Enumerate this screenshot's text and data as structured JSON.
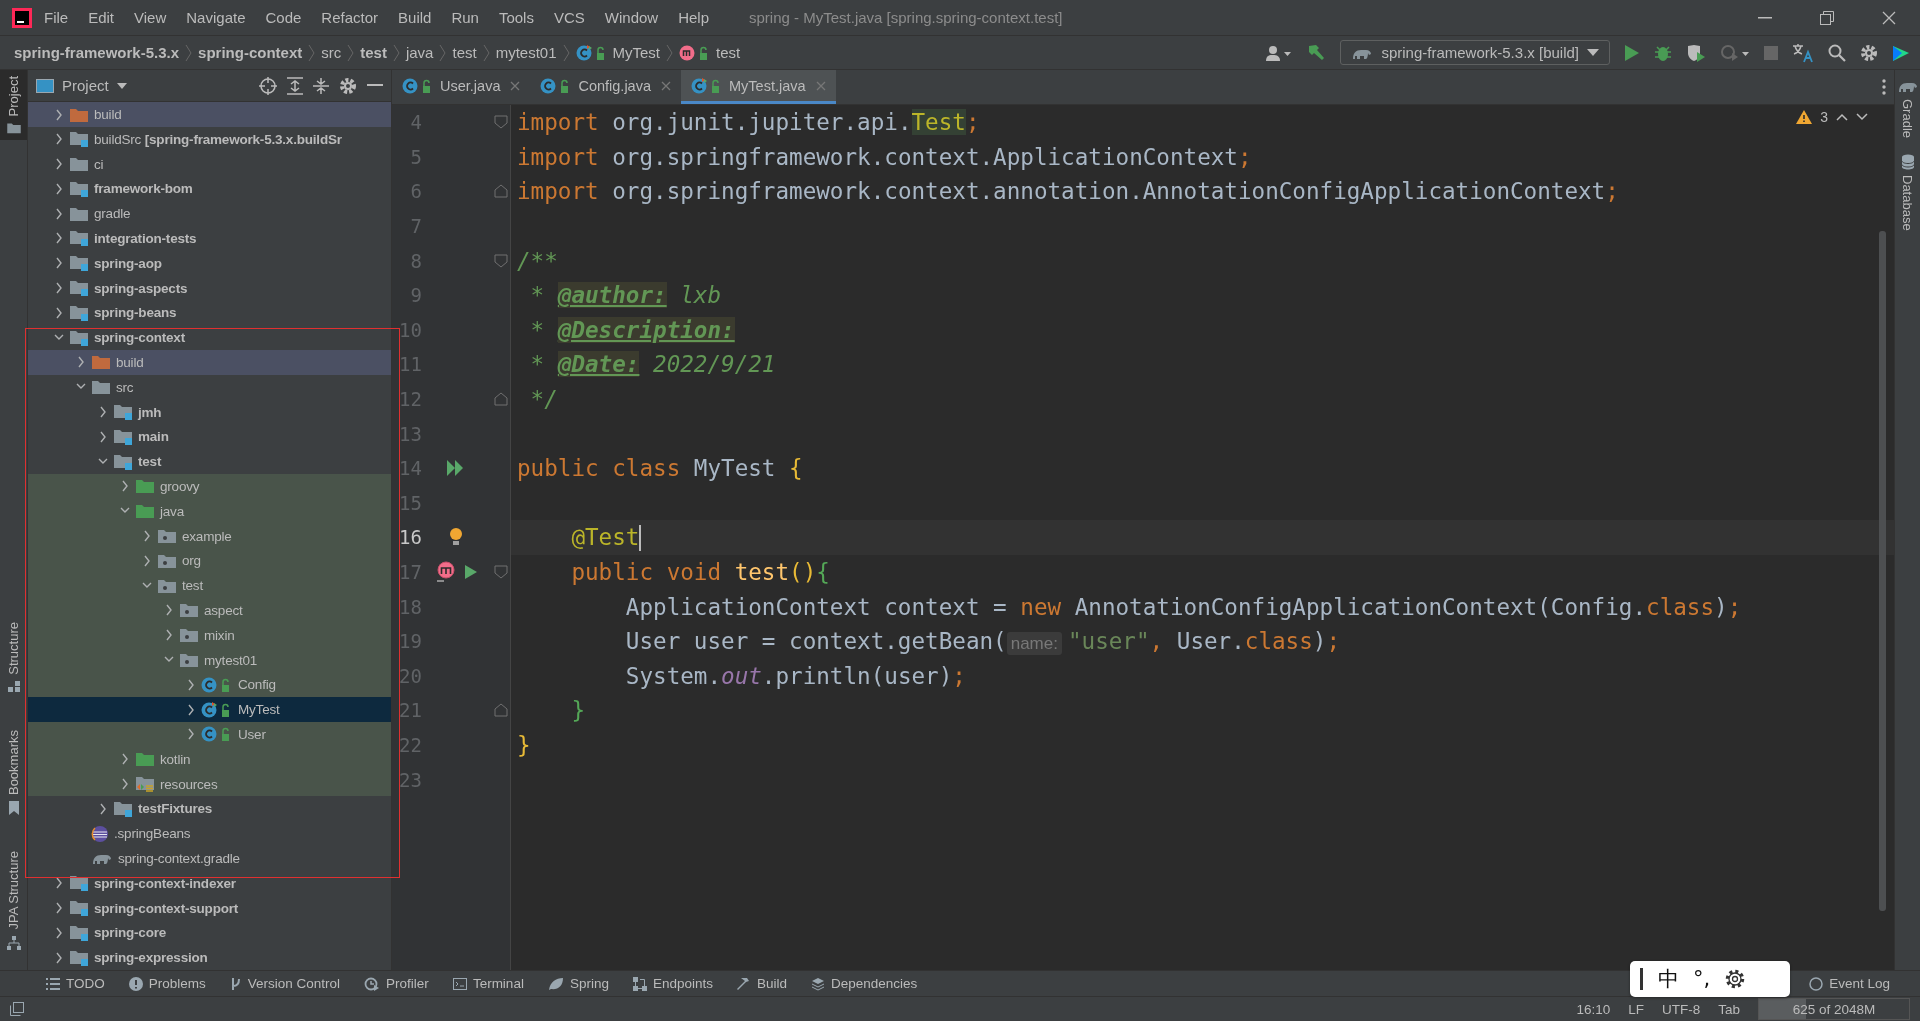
{
  "menu": [
    "File",
    "Edit",
    "View",
    "Navigate",
    "Code",
    "Refactor",
    "Build",
    "Run",
    "Tools",
    "VCS",
    "Window",
    "Help"
  ],
  "window": {
    "title": "spring - MyTest.java [spring.spring-context.test]"
  },
  "breadcrumbs": [
    {
      "label": "spring-framework-5.3.x",
      "bold": true,
      "kind": "plain"
    },
    {
      "label": "spring-context",
      "bold": true,
      "kind": "plain"
    },
    {
      "label": "src",
      "bold": false,
      "kind": "plain"
    },
    {
      "label": "test",
      "bold": true,
      "kind": "plain"
    },
    {
      "label": "java",
      "bold": false,
      "kind": "plain"
    },
    {
      "label": "test",
      "bold": false,
      "kind": "plain"
    },
    {
      "label": "mytest01",
      "bold": false,
      "kind": "plain"
    },
    {
      "label": "MyTest",
      "bold": false,
      "kind": "testclass"
    },
    {
      "label": "test",
      "bold": false,
      "kind": "method"
    }
  ],
  "run_config": {
    "label": "spring-framework-5.3.x [build]"
  },
  "left_stripe": [
    {
      "label": "Project",
      "selected": true,
      "kind": "folder"
    },
    {
      "label": "Structure",
      "selected": false,
      "kind": "structure"
    },
    {
      "label": "Bookmarks",
      "selected": false,
      "kind": "bookmark"
    },
    {
      "label": "JPA Structure",
      "selected": false,
      "kind": "hierarchy"
    }
  ],
  "right_stripe": [
    {
      "label": "Gradle",
      "kind": "gradle"
    },
    {
      "label": "Database",
      "kind": "database"
    }
  ],
  "project_panel": {
    "title": "Project",
    "tree": [
      {
        "label": "build",
        "kind": "folder",
        "excluded": true,
        "test_source": false,
        "selected": false,
        "expanded": false
      },
      {
        "label": "buildSrc **[spring-framework-5.3.x.buildSr**",
        "kind": "module",
        "excluded": false,
        "test_source": false,
        "selected": false,
        "expanded": false
      },
      {
        "label": "ci",
        "kind": "folder",
        "excluded": false,
        "test_source": false,
        "selected": false,
        "expanded": false
      },
      {
        "label": "**framework-bom**",
        "kind": "module",
        "excluded": false,
        "test_source": false,
        "selected": false,
        "expanded": false
      },
      {
        "label": "gradle",
        "kind": "folder",
        "excluded": false,
        "test_source": false,
        "selected": false,
        "expanded": false
      },
      {
        "label": "**integration-tests**",
        "kind": "module",
        "excluded": false,
        "test_source": false,
        "selected": false,
        "expanded": false
      },
      {
        "label": "**spring-aop**",
        "kind": "module",
        "excluded": false,
        "test_source": false,
        "selected": false,
        "expanded": false
      },
      {
        "label": "**spring-aspects**",
        "kind": "module",
        "excluded": false,
        "test_source": false,
        "selected": false,
        "expanded": false
      },
      {
        "label": "**spring-beans**",
        "kind": "module",
        "excluded": false,
        "test_source": false,
        "selected": false,
        "expanded": false
      },
      {
        "label": "**spring-context**",
        "kind": "module",
        "excluded": false,
        "test_source": false,
        "selected": false,
        "expanded": true,
        "children": [
          {
            "label": "build",
            "kind": "folder",
            "excluded": true,
            "test_source": false,
            "selected": false,
            "expanded": false
          },
          {
            "label": "src",
            "kind": "folder",
            "excluded": false,
            "test_source": false,
            "selected": false,
            "expanded": true,
            "children": [
              {
                "label": "**jmh**",
                "kind": "module",
                "excluded": false,
                "test_source": false,
                "selected": false,
                "expanded": false
              },
              {
                "label": "**main**",
                "kind": "module",
                "excluded": false,
                "test_source": false,
                "selected": false,
                "expanded": false
              },
              {
                "label": "**test**",
                "kind": "module",
                "excluded": false,
                "test_source": false,
                "selected": false,
                "expanded": true,
                "children": [
                  {
                    "label": "groovy",
                    "kind": "folder",
                    "excluded": false,
                    "test_source": true,
                    "selected": false,
                    "expanded": false
                  },
                  {
                    "label": "java",
                    "kind": "folder",
                    "excluded": false,
                    "test_source": true,
                    "selected": false,
                    "expanded": true,
                    "children": [
                      {
                        "label": "example",
                        "kind": "package",
                        "excluded": false,
                        "test_source": true,
                        "selected": false,
                        "expanded": false
                      },
                      {
                        "label": "org",
                        "kind": "package",
                        "excluded": false,
                        "test_source": true,
                        "selected": false,
                        "expanded": false
                      },
                      {
                        "label": "test",
                        "kind": "package",
                        "excluded": false,
                        "test_source": true,
                        "selected": false,
                        "expanded": true,
                        "children": [
                          {
                            "label": "aspect",
                            "kind": "package",
                            "excluded": false,
                            "test_source": true,
                            "selected": false,
                            "expanded": false
                          },
                          {
                            "label": "mixin",
                            "kind": "package",
                            "excluded": false,
                            "test_source": true,
                            "selected": false,
                            "expanded": false
                          },
                          {
                            "label": "mytest01",
                            "kind": "package",
                            "excluded": false,
                            "test_source": true,
                            "selected": false,
                            "expanded": true,
                            "children": [
                              {
                                "label": "Config",
                                "kind": "class",
                                "excluded": false,
                                "test_source": true,
                                "selected": false,
                                "expanded": false
                              },
                              {
                                "label": "MyTest",
                                "kind": "testclass",
                                "excluded": false,
                                "test_source": true,
                                "selected": true,
                                "expanded": false
                              },
                              {
                                "label": "User",
                                "kind": "class",
                                "excluded": false,
                                "test_source": true,
                                "selected": false,
                                "expanded": false
                              }
                            ]
                          }
                        ]
                      }
                    ]
                  },
                  {
                    "label": "kotlin",
                    "kind": "folder",
                    "excluded": false,
                    "test_source": true,
                    "selected": false,
                    "expanded": false
                  },
                  {
                    "label": "resources",
                    "kind": "resources",
                    "excluded": false,
                    "test_source": true,
                    "selected": false,
                    "expanded": false
                  }
                ]
              },
              {
                "label": "**testFixtures**",
                "kind": "module",
                "excluded": false,
                "test_source": false,
                "selected": false,
                "expanded": false
              }
            ]
          },
          {
            "label": ".springBeans",
            "kind": "beans",
            "excluded": false,
            "test_source": false,
            "selected": false
          },
          {
            "label": "spring-context.gradle",
            "kind": "gradle",
            "excluded": false,
            "test_source": false,
            "selected": false
          }
        ]
      },
      {
        "label": "**spring-context-indexer**",
        "kind": "module",
        "excluded": false,
        "test_source": false,
        "selected": false,
        "expanded": false
      },
      {
        "label": "**spring-context-support**",
        "kind": "module",
        "excluded": false,
        "test_source": false,
        "selected": false,
        "expanded": false
      },
      {
        "label": "**spring-core**",
        "kind": "module",
        "excluded": false,
        "test_source": false,
        "selected": false,
        "expanded": false
      },
      {
        "label": "**spring-expression**",
        "kind": "module",
        "excluded": false,
        "test_source": false,
        "selected": false,
        "expanded": false
      }
    ]
  },
  "tabs": [
    {
      "label": "User.java",
      "selected": false,
      "kind": "class"
    },
    {
      "label": "Config.java",
      "selected": false,
      "kind": "class"
    },
    {
      "label": "MyTest.java",
      "selected": true,
      "kind": "testclass"
    }
  ],
  "inspection": {
    "count": "3"
  },
  "code": [
    {
      "number": "4",
      "current": false,
      "fold": {
        "kind": "start"
      },
      "tokens": [
        {
          "kind": "keyword",
          "text": "import"
        },
        {
          "kind": "text",
          "text": " org.junit.jupiter.api."
        },
        {
          "kind": "marked",
          "text": "Test"
        },
        {
          "kind": "keyword",
          "text": ";"
        }
      ]
    },
    {
      "number": "5",
      "current": false,
      "tokens": [
        {
          "kind": "keyword",
          "text": "import"
        },
        {
          "kind": "text",
          "text": " org.springframework.context.ApplicationContext"
        },
        {
          "kind": "keyword",
          "text": ";"
        }
      ]
    },
    {
      "number": "6",
      "current": false,
      "fold": {
        "kind": "end"
      },
      "tokens": [
        {
          "kind": "keyword",
          "text": "import"
        },
        {
          "kind": "text",
          "text": " org.springframework.context.annotation.AnnotationConfigApplicationContext"
        },
        {
          "kind": "keyword",
          "text": ";"
        }
      ]
    },
    {
      "number": "7",
      "current": false
    },
    {
      "number": "8",
      "current": false,
      "fold": {
        "kind": "start"
      },
      "tokens": [
        {
          "kind": "comment",
          "text": "/**"
        }
      ]
    },
    {
      "number": "9",
      "current": false,
      "tokens": [
        {
          "kind": "comment",
          "text": " * "
        },
        {
          "kind": "doctag",
          "text": "@author:"
        },
        {
          "kind": "comment",
          "text": " lxb"
        }
      ]
    },
    {
      "number": "10",
      "current": false,
      "tokens": [
        {
          "kind": "comment",
          "text": " * "
        },
        {
          "kind": "doctag",
          "text": "@Description:"
        }
      ]
    },
    {
      "number": "11",
      "current": false,
      "tokens": [
        {
          "kind": "comment",
          "text": " * "
        },
        {
          "kind": "doctag",
          "text": "@Date:"
        },
        {
          "kind": "comment",
          "text": " 2022/9/21"
        }
      ]
    },
    {
      "number": "12",
      "current": false,
      "fold": {
        "kind": "end"
      },
      "tokens": [
        {
          "kind": "comment",
          "text": " */"
        }
      ]
    },
    {
      "number": "13",
      "current": false
    },
    {
      "number": "14",
      "current": false,
      "markers": [
        {
          "kind": "runall"
        }
      ],
      "tokens": [
        {
          "kind": "keyword",
          "text": "public class"
        },
        {
          "kind": "text",
          "text": " MyTest "
        },
        {
          "kind": "gold",
          "text": "{"
        }
      ]
    },
    {
      "number": "15",
      "current": false
    },
    {
      "number": "16",
      "current": true,
      "markers": [
        {
          "kind": "bulb"
        }
      ],
      "tokens": [
        {
          "kind": "annotation",
          "text": "    @Test"
        }
      ]
    },
    {
      "number": "17",
      "current": false,
      "markers": [
        {
          "kind": "override"
        },
        {
          "kind": "run"
        }
      ],
      "fold": {
        "kind": "start"
      },
      "tokens": [
        {
          "kind": "keyword",
          "text": "    public void"
        },
        {
          "kind": "method",
          "text": " test"
        },
        {
          "kind": "gold",
          "text": "()"
        },
        {
          "kind": "green",
          "text": "{"
        }
      ]
    },
    {
      "number": "18",
      "current": false,
      "tokens": [
        {
          "kind": "text",
          "text": "        ApplicationContext context = "
        },
        {
          "kind": "keyword",
          "text": "new"
        },
        {
          "kind": "text",
          "text": " AnnotationConfigApplicationContext(Config."
        },
        {
          "kind": "keyword",
          "text": "class"
        },
        {
          "kind": "text",
          "text": ")"
        },
        {
          "kind": "keyword",
          "text": ";"
        }
      ]
    },
    {
      "number": "19",
      "current": false,
      "tokens": [
        {
          "kind": "text",
          "text": "        User user = context.getBean("
        },
        {
          "kind": "hint",
          "text": "name:"
        },
        {
          "kind": "string",
          "text": "\"user\""
        },
        {
          "kind": "keyword",
          "text": ", "
        },
        {
          "kind": "text",
          "text": "User."
        },
        {
          "kind": "keyword",
          "text": "class"
        },
        {
          "kind": "text",
          "text": ")"
        },
        {
          "kind": "keyword",
          "text": ";"
        }
      ]
    },
    {
      "number": "20",
      "current": false,
      "tokens": [
        {
          "kind": "text",
          "text": "        System."
        },
        {
          "kind": "field",
          "text": "out"
        },
        {
          "kind": "text",
          "text": ".println(user)"
        },
        {
          "kind": "keyword",
          "text": ";"
        }
      ]
    },
    {
      "number": "21",
      "current": false,
      "fold": {
        "kind": "end"
      },
      "tokens": [
        {
          "kind": "green",
          "text": "    }"
        }
      ]
    },
    {
      "number": "22",
      "current": false,
      "tokens": [
        {
          "kind": "gold",
          "text": "}"
        }
      ]
    },
    {
      "number": "23",
      "current": false
    }
  ],
  "bottom_tools": [
    {
      "label": "TODO",
      "kind": "list"
    },
    {
      "label": "Problems",
      "kind": "alert"
    },
    {
      "label": "Version Control",
      "kind": "branch"
    },
    {
      "label": "Profiler",
      "kind": "profiler"
    },
    {
      "label": "Terminal",
      "kind": "terminal"
    },
    {
      "label": "Spring",
      "kind": "leaf"
    },
    {
      "label": "Endpoints",
      "kind": "endpoints"
    },
    {
      "label": "Build",
      "kind": "hammer"
    },
    {
      "label": "Dependencies",
      "kind": "layers"
    }
  ],
  "event_log": {
    "label": "Event Log"
  },
  "status_bar": {
    "items": [
      "16:10",
      "LF",
      "UTF-8",
      "Tab"
    ],
    "memory": {
      "label": "625 of 2048M",
      "level": 0.31
    }
  },
  "ime_toolbar": {
    "items": [
      "中",
      "°,"
    ]
  }
}
